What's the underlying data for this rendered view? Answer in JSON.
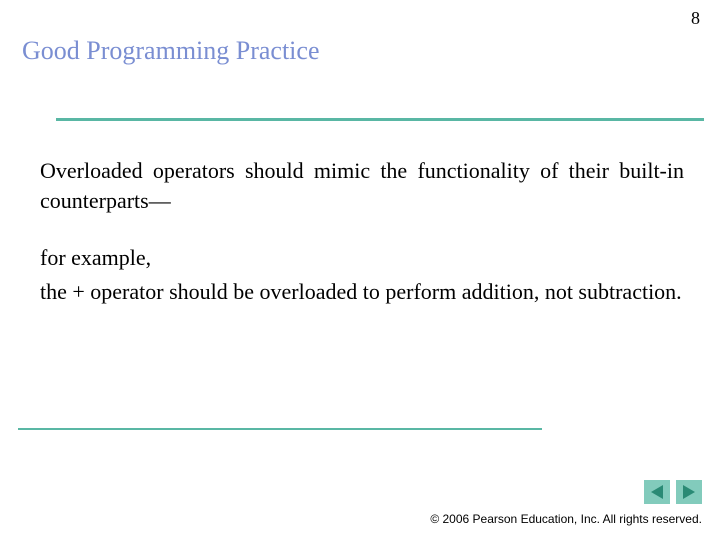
{
  "page_number": "8",
  "title": "Good Programming Practice",
  "body": {
    "p1": "Overloaded operators should mimic the functionality of their built-in counterparts—",
    "p2": "for example,",
    "p3": "the + operator should be overloaded to perform addition, not subtraction."
  },
  "footer": {
    "copyright": "© 2006 Pearson Education, Inc.  All rights reserved."
  },
  "nav": {
    "prev": "previous",
    "next": "next"
  }
}
